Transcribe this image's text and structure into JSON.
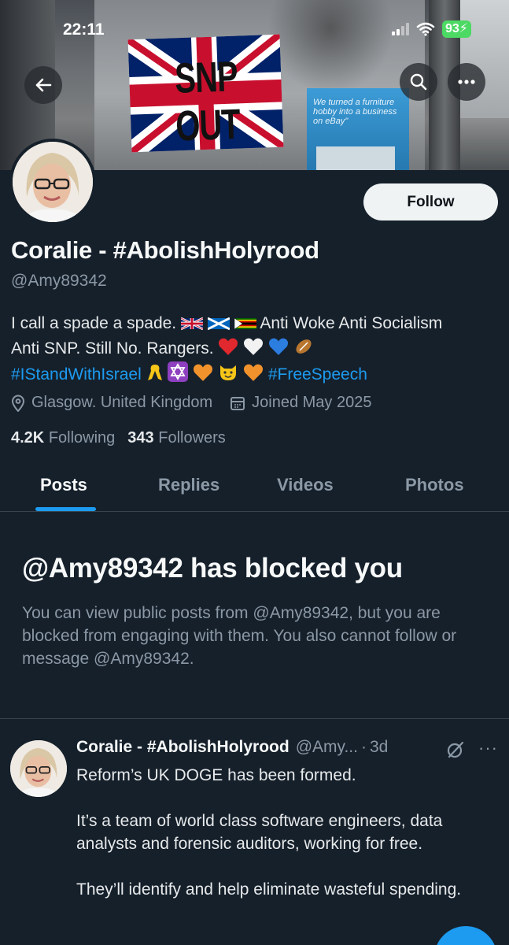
{
  "status_bar": {
    "time": "22:11",
    "battery": "93"
  },
  "banner": {
    "sign_text": "SNP OUT",
    "ad_text": "We turned a furniture hobby into a business on eBay\""
  },
  "header": {
    "follow_label": "Follow"
  },
  "profile": {
    "display_name": "Coralie - #AbolishHolyrood",
    "handle": "@Amy89342",
    "bio_line1": "I call a spade a spade.",
    "bio_line1b": "Anti Woke Anti Socialism",
    "bio_line2": "Anti SNP. Still No. Rangers.",
    "bio_tag1": "#IStandWithIsrael",
    "bio_tag2": "#FreeSpeech",
    "location": "Glasgow. United Kingdom",
    "joined": "Joined May 2025",
    "following_count": "4.2K",
    "following_label": "Following",
    "followers_count": "343",
    "followers_label": "Followers"
  },
  "tabs": [
    "Posts",
    "Replies",
    "Videos",
    "Photos"
  ],
  "blocked": {
    "title": "@Amy89342 has blocked you",
    "body": "You can view public posts from @Amy89342, but you are blocked from engaging with them. You also cannot follow or message @Amy89342."
  },
  "post": {
    "name": "Coralie - #AbolishHolyrood",
    "handle": "@Amy...",
    "dot": "·",
    "time": "3d",
    "more": "···",
    "paragraphs": [
      "Reform’s UK DOGE has been formed.",
      "It’s a team of world class software engineers, data analysts and forensic auditors, working for free.",
      "They’ll identify and help eliminate wasteful spending."
    ]
  },
  "colors": {
    "accent": "#1d9bf0",
    "background": "#15202b",
    "muted": "#8b98a5"
  }
}
